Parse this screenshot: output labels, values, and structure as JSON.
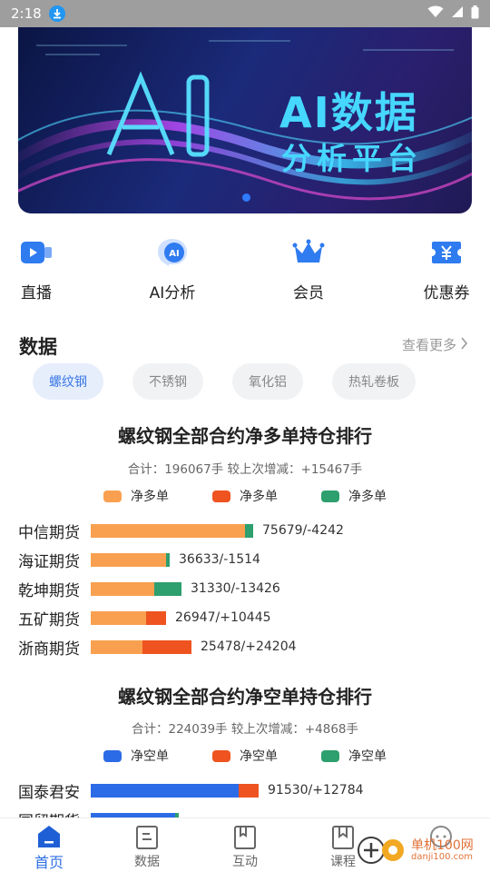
{
  "status": {
    "time": "2:18"
  },
  "banner": {
    "line1": "AI数据",
    "line2": "分析平台"
  },
  "quick": [
    {
      "label": "直播",
      "icon": "live-video-icon"
    },
    {
      "label": "AI分析",
      "icon": "ai-head-icon"
    },
    {
      "label": "会员",
      "icon": "crown-icon"
    },
    {
      "label": "优惠券",
      "icon": "coupon-yen-icon"
    }
  ],
  "section": {
    "title": "数据",
    "more": "查看更多"
  },
  "chips": [
    "螺纹钢",
    "不锈钢",
    "氧化铝",
    "热轧卷板"
  ],
  "long": {
    "title": "螺纹钢全部合约净多单持仓排行",
    "summary": "合计：196067手  较上次增减：+15467手",
    "legend": [
      "净多单",
      "净多单",
      "净多单"
    ],
    "colors": [
      "#f9a050",
      "#ee5320",
      "#2e9f6e"
    ],
    "rows": [
      {
        "name": "中信期货",
        "value": "75679/-4242",
        "segs": [
          0.92,
          0.0,
          0.05
        ]
      },
      {
        "name": "海证期货",
        "value": "36633/-1514",
        "segs": [
          0.45,
          0.0,
          0.02
        ]
      },
      {
        "name": "乾坤期货",
        "value": "31330/-13426",
        "segs": [
          0.38,
          0.0,
          0.16
        ]
      },
      {
        "name": "五矿期货",
        "value": "26947/+10445",
        "segs": [
          0.33,
          0.12,
          0.0
        ]
      },
      {
        "name": "浙商期货",
        "value": "25478/+24204",
        "segs": [
          0.31,
          0.29,
          0.0
        ]
      }
    ]
  },
  "short": {
    "title": "螺纹钢全部合约净空单持仓排行",
    "summary": "合计：224039手  较上次增减：+4868手",
    "legend": [
      "净空单",
      "净空单",
      "净空单"
    ],
    "colors": [
      "#2c6be6",
      "#ee5320",
      "#2e9f6e"
    ],
    "rows": [
      {
        "name": "国泰君安",
        "value": "91530/+12784",
        "segs": [
          0.88,
          0.12,
          0.0
        ]
      },
      {
        "name": "国贸期货",
        "value": "",
        "segs": [
          0.5,
          0.0,
          0.02
        ]
      }
    ]
  },
  "tabs": [
    {
      "label": "首页",
      "icon": "home-icon",
      "active": true
    },
    {
      "label": "数据",
      "icon": "data-doc-icon",
      "active": false
    },
    {
      "label": "互动",
      "icon": "interaction-book-icon",
      "active": false
    },
    {
      "label": "课程",
      "icon": "course-bookmark-icon",
      "active": false
    },
    {
      "label": "",
      "icon": "chat-bubble-icon",
      "active": false
    }
  ],
  "watermark": {
    "name": "单机100网",
    "url": "danji100.com"
  }
}
